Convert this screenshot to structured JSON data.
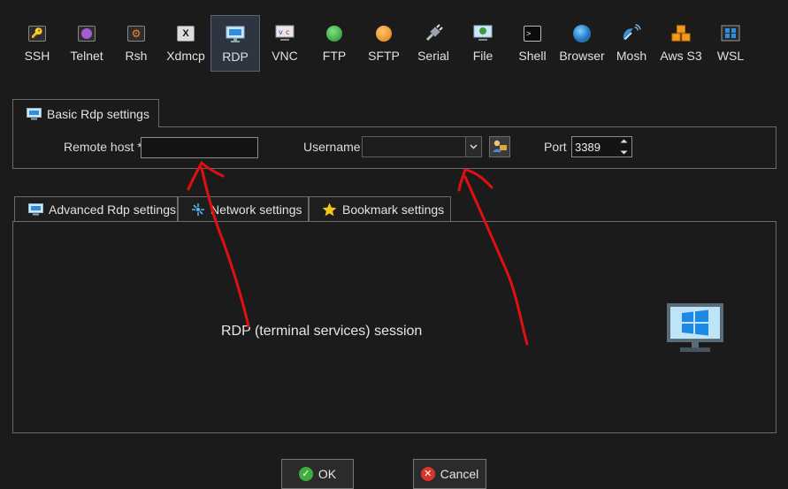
{
  "toolbar": {
    "items": [
      {
        "label": "SSH",
        "icon": "ssh-key-icon"
      },
      {
        "label": "Telnet",
        "icon": "telnet-icon"
      },
      {
        "label": "Rsh",
        "icon": "rsh-icon"
      },
      {
        "label": "Xdmcp",
        "icon": "xdmcp-icon"
      },
      {
        "label": "RDP",
        "icon": "rdp-monitor-icon",
        "selected": true
      },
      {
        "label": "VNC",
        "icon": "vnc-icon"
      },
      {
        "label": "FTP",
        "icon": "ftp-globe-icon"
      },
      {
        "label": "SFTP",
        "icon": "sftp-globe-icon"
      },
      {
        "label": "Serial",
        "icon": "serial-plug-icon"
      },
      {
        "label": "File",
        "icon": "file-icon"
      },
      {
        "label": "Shell",
        "icon": "shell-terminal-icon"
      },
      {
        "label": "Browser",
        "icon": "browser-globe-icon"
      },
      {
        "label": "Mosh",
        "icon": "mosh-satellite-icon"
      },
      {
        "label": "Aws S3",
        "icon": "aws-s3-boxes-icon"
      },
      {
        "label": "WSL",
        "icon": "wsl-windows-icon"
      }
    ]
  },
  "basic": {
    "tab_label": "Basic Rdp settings",
    "remote_host_label": "Remote host *",
    "remote_host_value": "",
    "username_label": "Username",
    "username_value": "",
    "port_label": "Port",
    "port_value": "3389"
  },
  "lower_tabs": {
    "advanced": "Advanced Rdp settings",
    "network": "Network settings",
    "bookmark": "Bookmark settings"
  },
  "panel": {
    "session_text": "RDP (terminal services) session"
  },
  "buttons": {
    "ok": "OK",
    "cancel": "Cancel"
  },
  "colors": {
    "background": "#1b1b1b",
    "border": "#6b6b6b",
    "selected_tool_bg": "#2e3440",
    "annotation_red": "#e01010",
    "ok_green": "#3fae3f",
    "cancel_red": "#d9342b",
    "windows_blue": "#1e88e5"
  }
}
